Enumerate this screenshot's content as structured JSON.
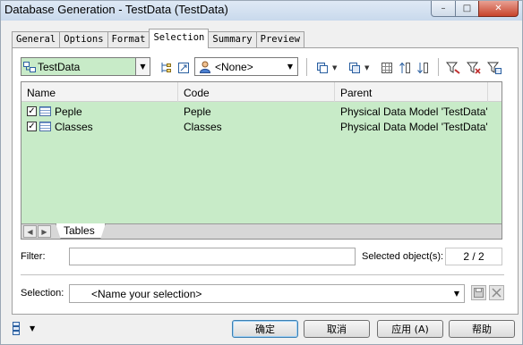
{
  "window": {
    "title": "Database Generation - TestData (TestData)",
    "controls": {
      "minimize": "–",
      "maximize": "□",
      "close": "✕"
    }
  },
  "tabs": [
    {
      "label": "General",
      "active": false
    },
    {
      "label": "Options",
      "active": false
    },
    {
      "label": "Format",
      "active": false
    },
    {
      "label": "Selection",
      "active": true
    },
    {
      "label": "Summary",
      "active": false
    },
    {
      "label": "Preview",
      "active": false
    }
  ],
  "toolbar": {
    "model_combo": {
      "value": "TestData",
      "icon": "model-icon"
    },
    "owner_combo": {
      "value": "<None>",
      "icon": "user-icon"
    },
    "icons": [
      "tree-icon",
      "properties-icon",
      "select-all-icon",
      "deselect-all-icon",
      "grid-icon",
      "sort-up-icon",
      "sort-down-icon",
      "filter-icon",
      "clear-filter-icon",
      "filter-options-icon"
    ]
  },
  "grid": {
    "columns": [
      "Name",
      "Code",
      "Parent"
    ],
    "rows": [
      {
        "checked": true,
        "name": "Peple",
        "code": "Peple",
        "parent": "Physical Data Model 'TestData'"
      },
      {
        "checked": true,
        "name": "Classes",
        "code": "Classes",
        "parent": "Physical Data Model 'TestData'"
      }
    ],
    "sheet_tab": "Tables",
    "background": "#c8ebc8"
  },
  "filter": {
    "label": "Filter:",
    "value": ""
  },
  "selected_objects": {
    "label": "Selected object(s):",
    "value": "2 / 2"
  },
  "selection": {
    "label": "Selection:",
    "value": "<Name your selection>"
  },
  "buttons": {
    "ok": "确定",
    "cancel": "取消",
    "apply": "应用 (A)",
    "help": "帮助"
  },
  "colors": {
    "grid_bg": "#c8ebc8",
    "combo_bg": "#c8ebc8"
  }
}
